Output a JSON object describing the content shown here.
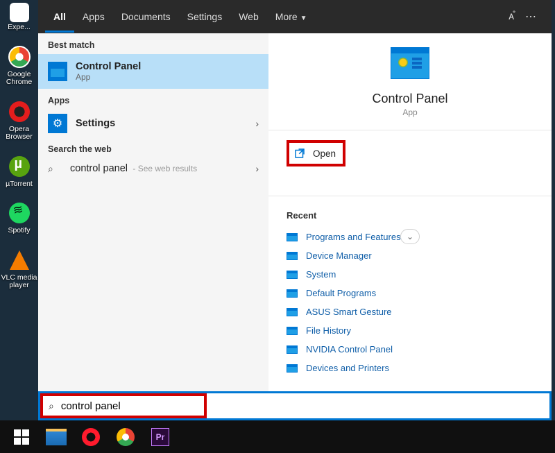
{
  "desktop": {
    "icons": [
      {
        "label": "Expe..."
      },
      {
        "label": "Google Chrome"
      },
      {
        "label": "Opera Browser"
      },
      {
        "label": "µTorrent"
      },
      {
        "label": "Spotify"
      },
      {
        "label": "VLC media player"
      }
    ]
  },
  "tabs": {
    "all": "All",
    "apps": "Apps",
    "documents": "Documents",
    "settings": "Settings",
    "web": "Web",
    "more": "More"
  },
  "left": {
    "best_match": "Best match",
    "best_title": "Control Panel",
    "best_sub": "App",
    "apps_label": "Apps",
    "settings_label": "Settings",
    "web_label": "Search the web",
    "web_query": "control panel",
    "web_hint": " - See web results"
  },
  "preview": {
    "title": "Control Panel",
    "sub": "App",
    "open": "Open",
    "recent_label": "Recent",
    "recent": [
      "Programs and Features",
      "Device Manager",
      "System",
      "Default Programs",
      "ASUS Smart Gesture",
      "File History",
      "NVIDIA Control Panel",
      "Devices and Printers"
    ]
  },
  "search": {
    "value": "control panel"
  }
}
